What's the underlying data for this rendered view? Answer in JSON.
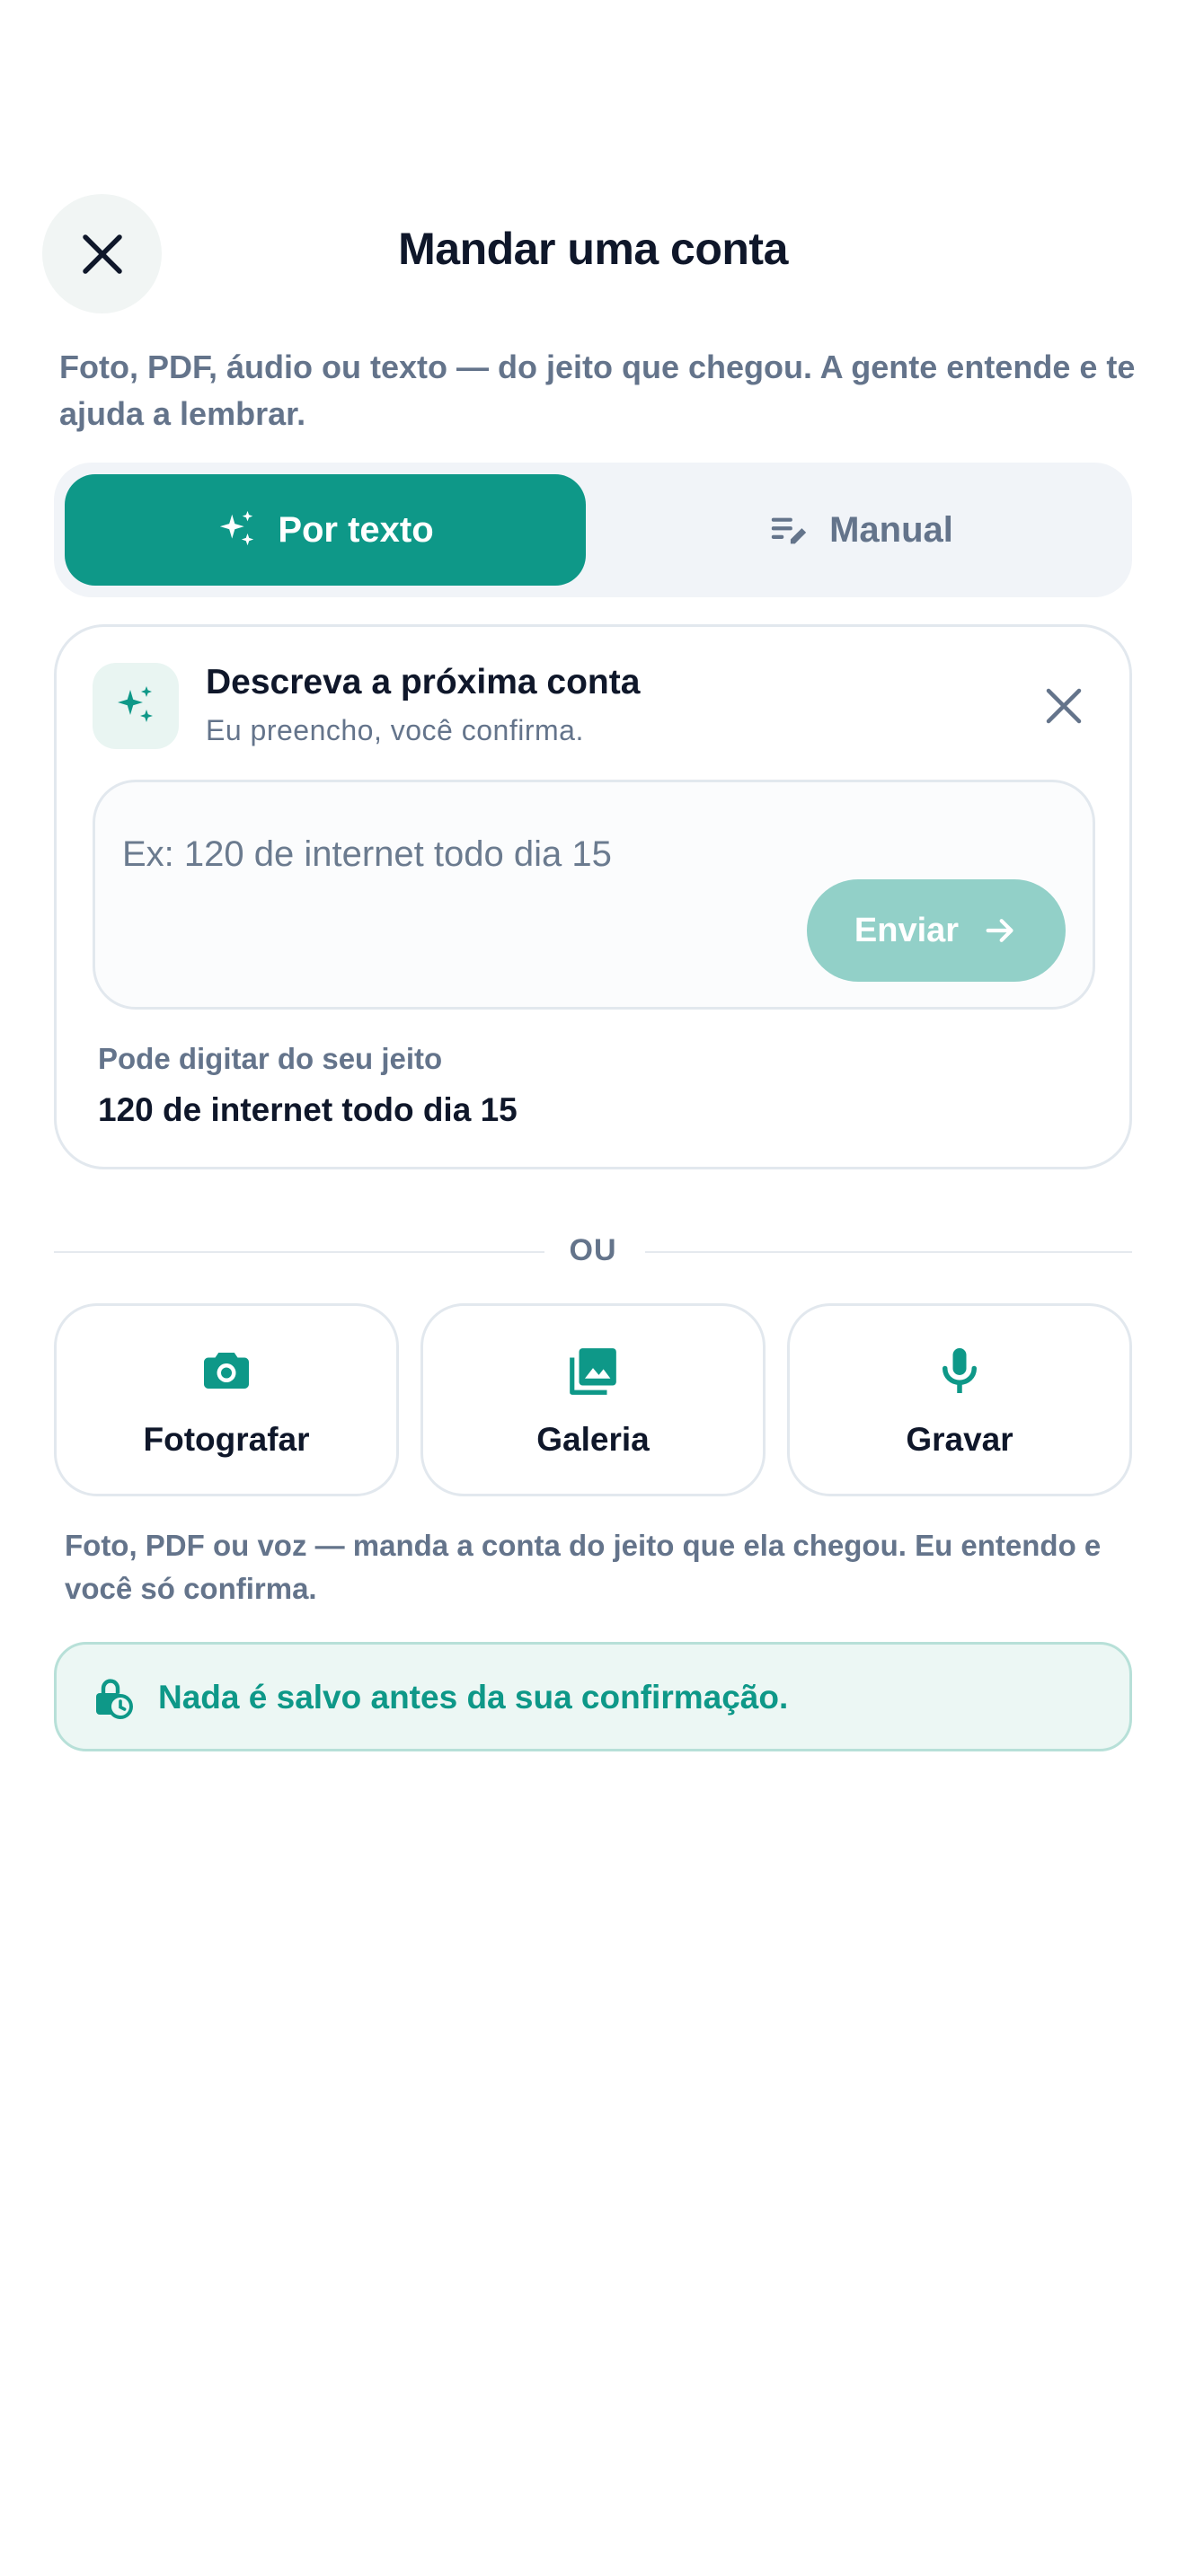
{
  "header": {
    "title": "Mandar uma conta",
    "subtitle": "Foto, PDF, áudio ou texto — do jeito que chegou. A gente entende e te ajuda a lembrar."
  },
  "tabs": [
    {
      "label": "Por texto",
      "icon": "sparkles-icon",
      "active": true
    },
    {
      "label": "Manual",
      "icon": "edit-note-icon",
      "active": false
    }
  ],
  "text_card": {
    "title": "Descreva a próxima conta",
    "subtitle": "Eu preencho, você confirma.",
    "input_placeholder": "Ex: 120 de internet todo dia 15",
    "input_value": "",
    "send_label": "Enviar",
    "hint_label": "Pode digitar do seu jeito",
    "hint_example": "120 de internet todo dia 15"
  },
  "divider_label": "OU",
  "actions": [
    {
      "label": "Fotografar",
      "icon": "camera-icon"
    },
    {
      "label": "Galeria",
      "icon": "gallery-icon"
    },
    {
      "label": "Gravar",
      "icon": "microphone-icon"
    }
  ],
  "note": "Foto, PDF ou voz — manda a conta do jeito que ela chegou. Eu entendo e você só confirma.",
  "banner": {
    "text": "Nada é salvo antes da sua confirmação.",
    "icon": "lock-clock-icon"
  },
  "colors": {
    "accent": "#0e9888",
    "accent_light": "#92d0c8",
    "muted_text": "#64748b",
    "dark_text": "#0f172a"
  }
}
